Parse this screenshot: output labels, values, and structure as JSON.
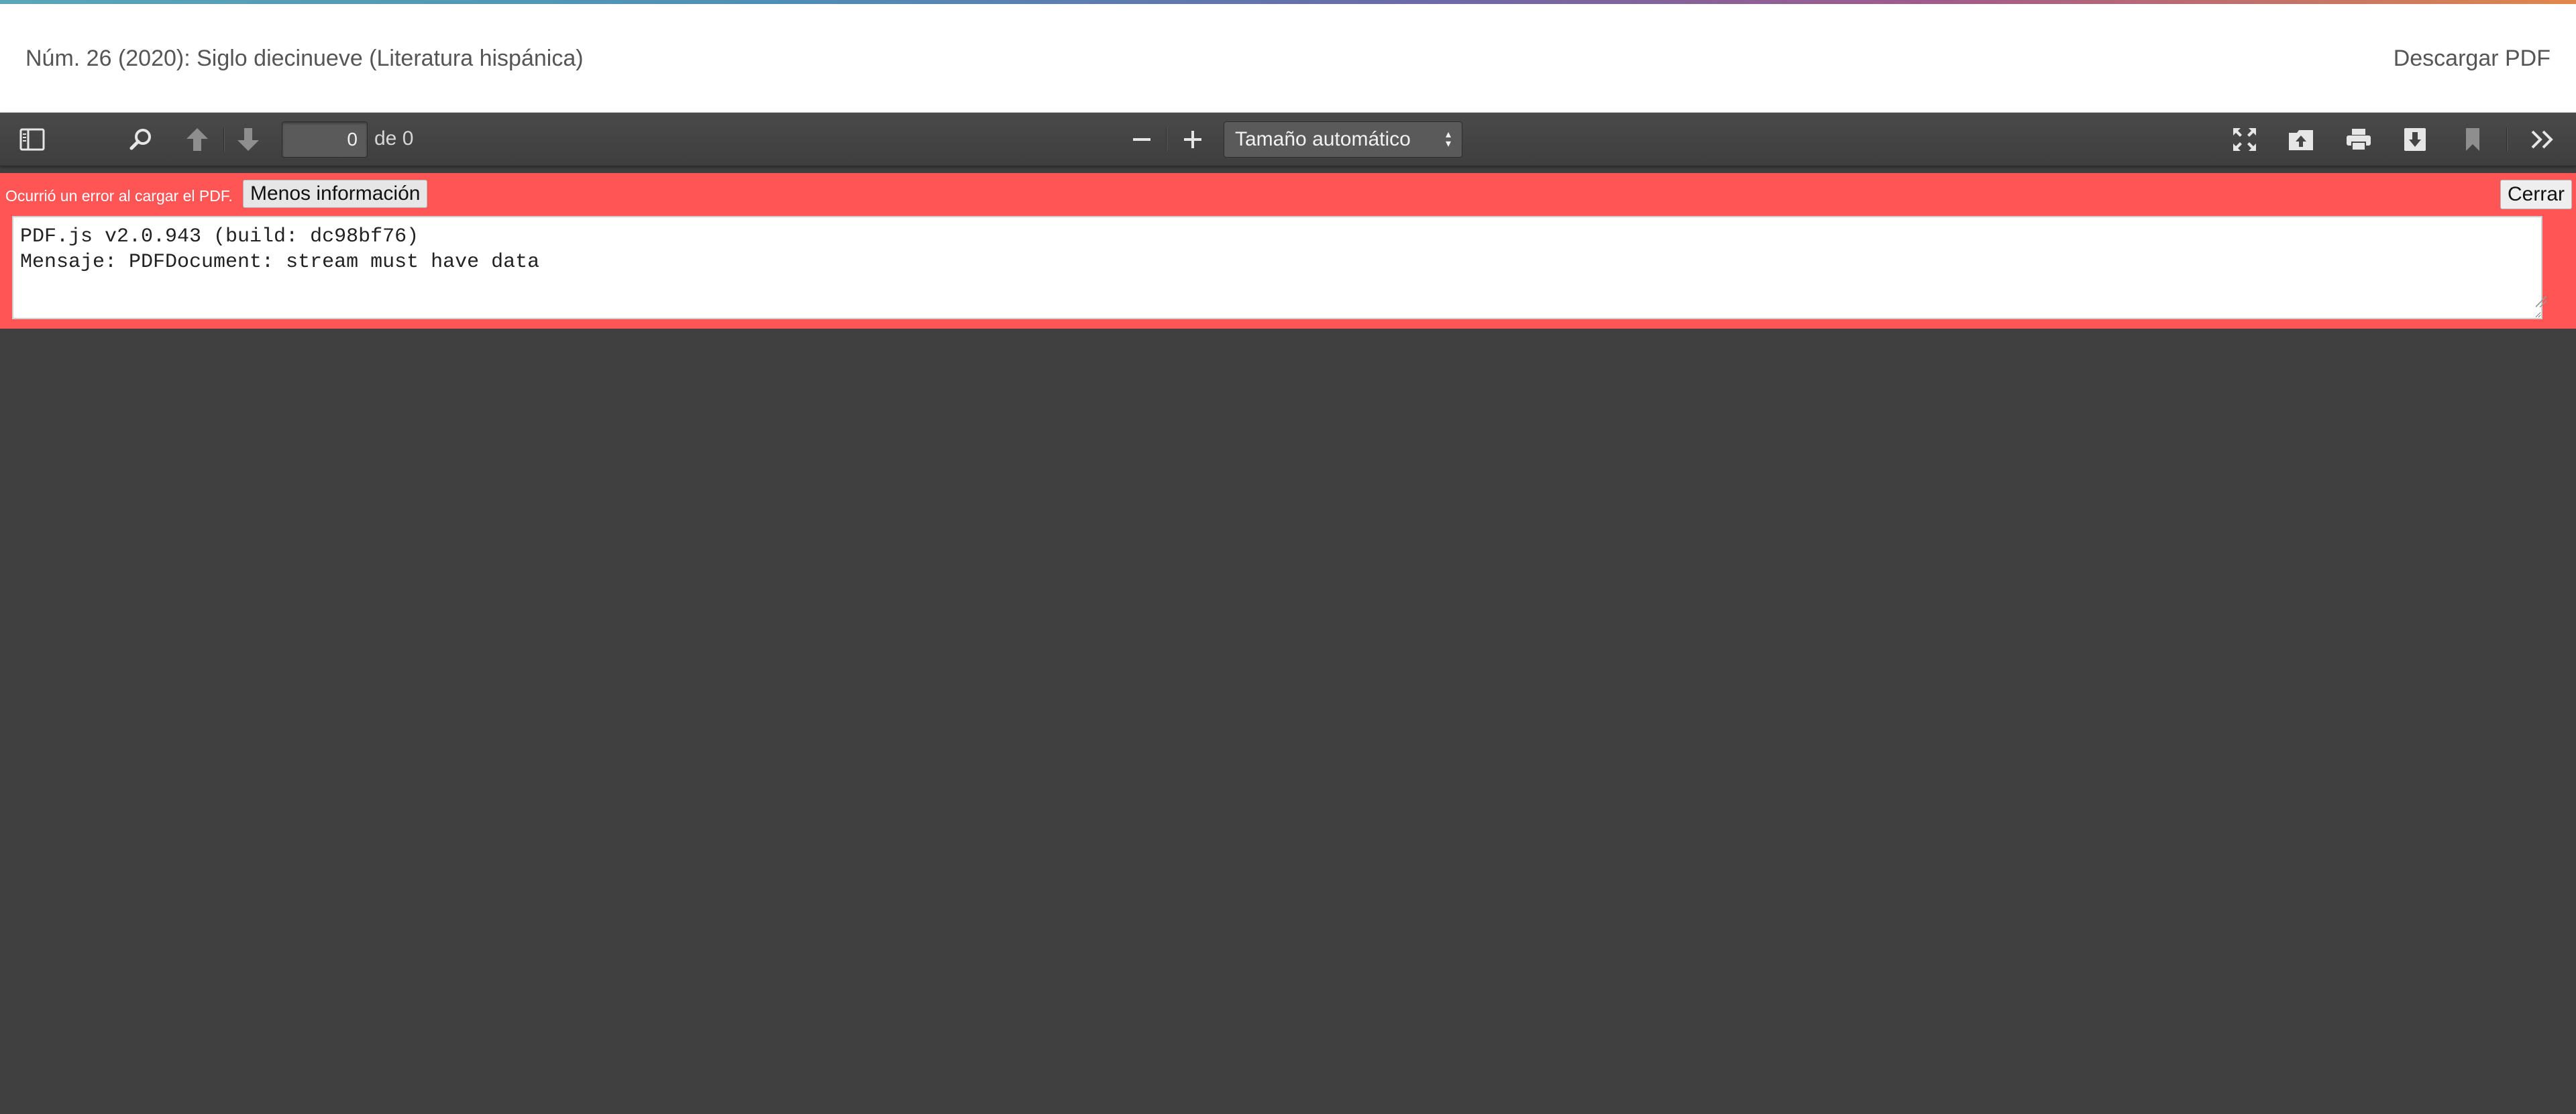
{
  "header": {
    "title": "Núm. 26 (2020): Siglo diecinueve (Literatura hispánica)",
    "download_label": "Descargar PDF"
  },
  "toolbar": {
    "page_number": "0",
    "page_count_label": "de 0",
    "zoom_selected": "Tamaño automático",
    "icons": {
      "sidebar": "sidebar-toggle-icon",
      "find": "search-icon",
      "prev": "arrow-up-icon",
      "next": "arrow-down-icon",
      "zoom_out": "minus-icon",
      "zoom_in": "plus-icon",
      "presentation": "fullscreen-icon",
      "open": "open-file-icon",
      "print": "print-icon",
      "download": "download-icon",
      "bookmark": "bookmark-icon",
      "tools": "double-chevron-right-icon"
    }
  },
  "error": {
    "message": "Ocurrió un error al cargar el PDF.",
    "less_info_label": "Menos información",
    "close_label": "Cerrar",
    "details": "PDF.js v2.0.943 (build: dc98bf76)\nMensaje: PDFDocument: stream must have data"
  },
  "colors": {
    "error_bg": "#ff5555",
    "toolbar_bg": "#474747",
    "viewer_bg": "#404040",
    "header_bg": "#ffffff"
  }
}
